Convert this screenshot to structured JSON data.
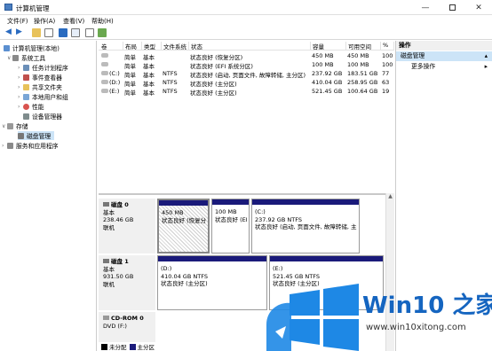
{
  "window": {
    "title": "计算机管理"
  },
  "menu": [
    "文件(F)",
    "操作(A)",
    "查看(V)",
    "帮助(H)"
  ],
  "tree": {
    "root": "计算机管理(本地)",
    "system_tools": "系统工具",
    "items": [
      "任务计划程序",
      "事件查看器",
      "共享文件夹",
      "本地用户和组",
      "性能",
      "设备管理器"
    ],
    "storage": "存储",
    "disk_mgmt": "磁盘管理",
    "services": "服务和应用程序"
  },
  "table": {
    "headers": [
      "卷",
      "布局",
      "类型",
      "文件系统",
      "状态",
      "容量",
      "可用空间",
      "%"
    ],
    "rows": [
      [
        "",
        "简单",
        "基本",
        "",
        "状态良好 (恢复分区)",
        "450 MB",
        "450 MB",
        "100"
      ],
      [
        "",
        "简单",
        "基本",
        "",
        "状态良好 (EFI 系统分区)",
        "100 MB",
        "100 MB",
        "100"
      ],
      [
        "(C:)",
        "简单",
        "基本",
        "NTFS",
        "状态良好 (启动, 页面文件, 故障转储, 主分区)",
        "237.92 GB",
        "183.51 GB",
        "77"
      ],
      [
        "(D:)",
        "简单",
        "基本",
        "NTFS",
        "状态良好 (主分区)",
        "410.04 GB",
        "258.95 GB",
        "63"
      ],
      [
        "(E:)",
        "简单",
        "基本",
        "NTFS",
        "状态良好 (主分区)",
        "521.45 GB",
        "100.64 GB",
        "19"
      ]
    ]
  },
  "actions": {
    "header": "操作",
    "subheader": "磁盘管理",
    "more": "更多操作"
  },
  "disks": [
    {
      "name": "磁盘 0",
      "type": "基本",
      "size": "238.46 GB",
      "status": "联机",
      "parts": [
        {
          "title": "",
          "size": "450 MB",
          "status": "状态良好 (恢复分区)"
        },
        {
          "title": "",
          "size": "100 MB",
          "status": "状态良好 (EFI 系统分区)"
        },
        {
          "title": "(C:)",
          "size": "237.92 GB NTFS",
          "status": "状态良好 (启动, 页面文件, 故障转储, 主分区)"
        }
      ]
    },
    {
      "name": "磁盘 1",
      "type": "基本",
      "size": "931.50 GB",
      "status": "联机",
      "parts": [
        {
          "title": "(D:)",
          "size": "410.04 GB NTFS",
          "status": "状态良好 (主分区)"
        },
        {
          "title": "(E:)",
          "size": "521.45 GB NTFS",
          "status": "状态良好 (主分区)"
        }
      ]
    },
    {
      "name": "CD-ROM 0",
      "type": "DVD (F:)",
      "size": "",
      "status": "",
      "parts": []
    }
  ],
  "legend": {
    "unallocated": "未分配",
    "primary": "主分区",
    "unallocated_color": "#000000",
    "primary_color": "#1a1a7a"
  },
  "watermark": {
    "brand": "Win10 之家",
    "url": "www.win10xitong.com",
    "accent": "#1e88e5"
  }
}
